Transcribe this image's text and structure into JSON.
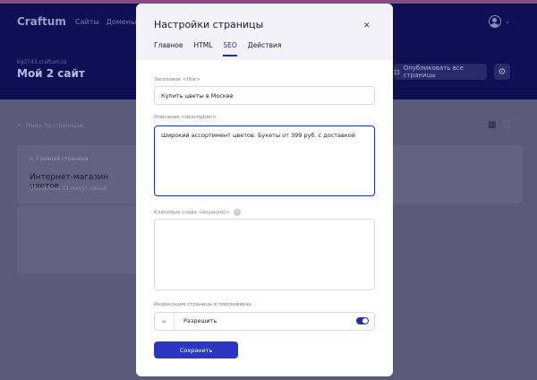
{
  "app": {
    "logo": "Craftum",
    "nav": [
      "Сайты",
      "Домены"
    ],
    "site_domain": "kg0743.craftum.io",
    "site_title": "Мой 2 сайт",
    "publish_label": "Опубликовать все страницы",
    "search_placeholder": "Поиск по страницам",
    "card": {
      "home_label": "Главная страница",
      "title": "Интернет-магазин цветов",
      "updated": "Обновлено 11 минут назад"
    }
  },
  "modal": {
    "title": "Настройки страницы",
    "tabs": [
      "Главное",
      "HTML",
      "SEO",
      "Действия"
    ],
    "active_tab": "SEO",
    "fields": {
      "title_label": "Заголовок <title>",
      "title_value": "Купить цветы в Москве",
      "description_label": "Описание <description>",
      "description_value": "Широкий ассортимент цветов. Букеты от 399 руб. с доставкой",
      "keywords_label": "Ключевые слова <keywords>",
      "keywords_value": ""
    },
    "indexing": {
      "label": "Индексация страницы в поисковиках",
      "option_label": "Разрешить",
      "enabled": true
    },
    "save_label": "Сохранить"
  },
  "colors": {
    "accent": "#2230a8",
    "header_bg": "#0f0f55",
    "overlay_bg": "#5a5a7a"
  }
}
